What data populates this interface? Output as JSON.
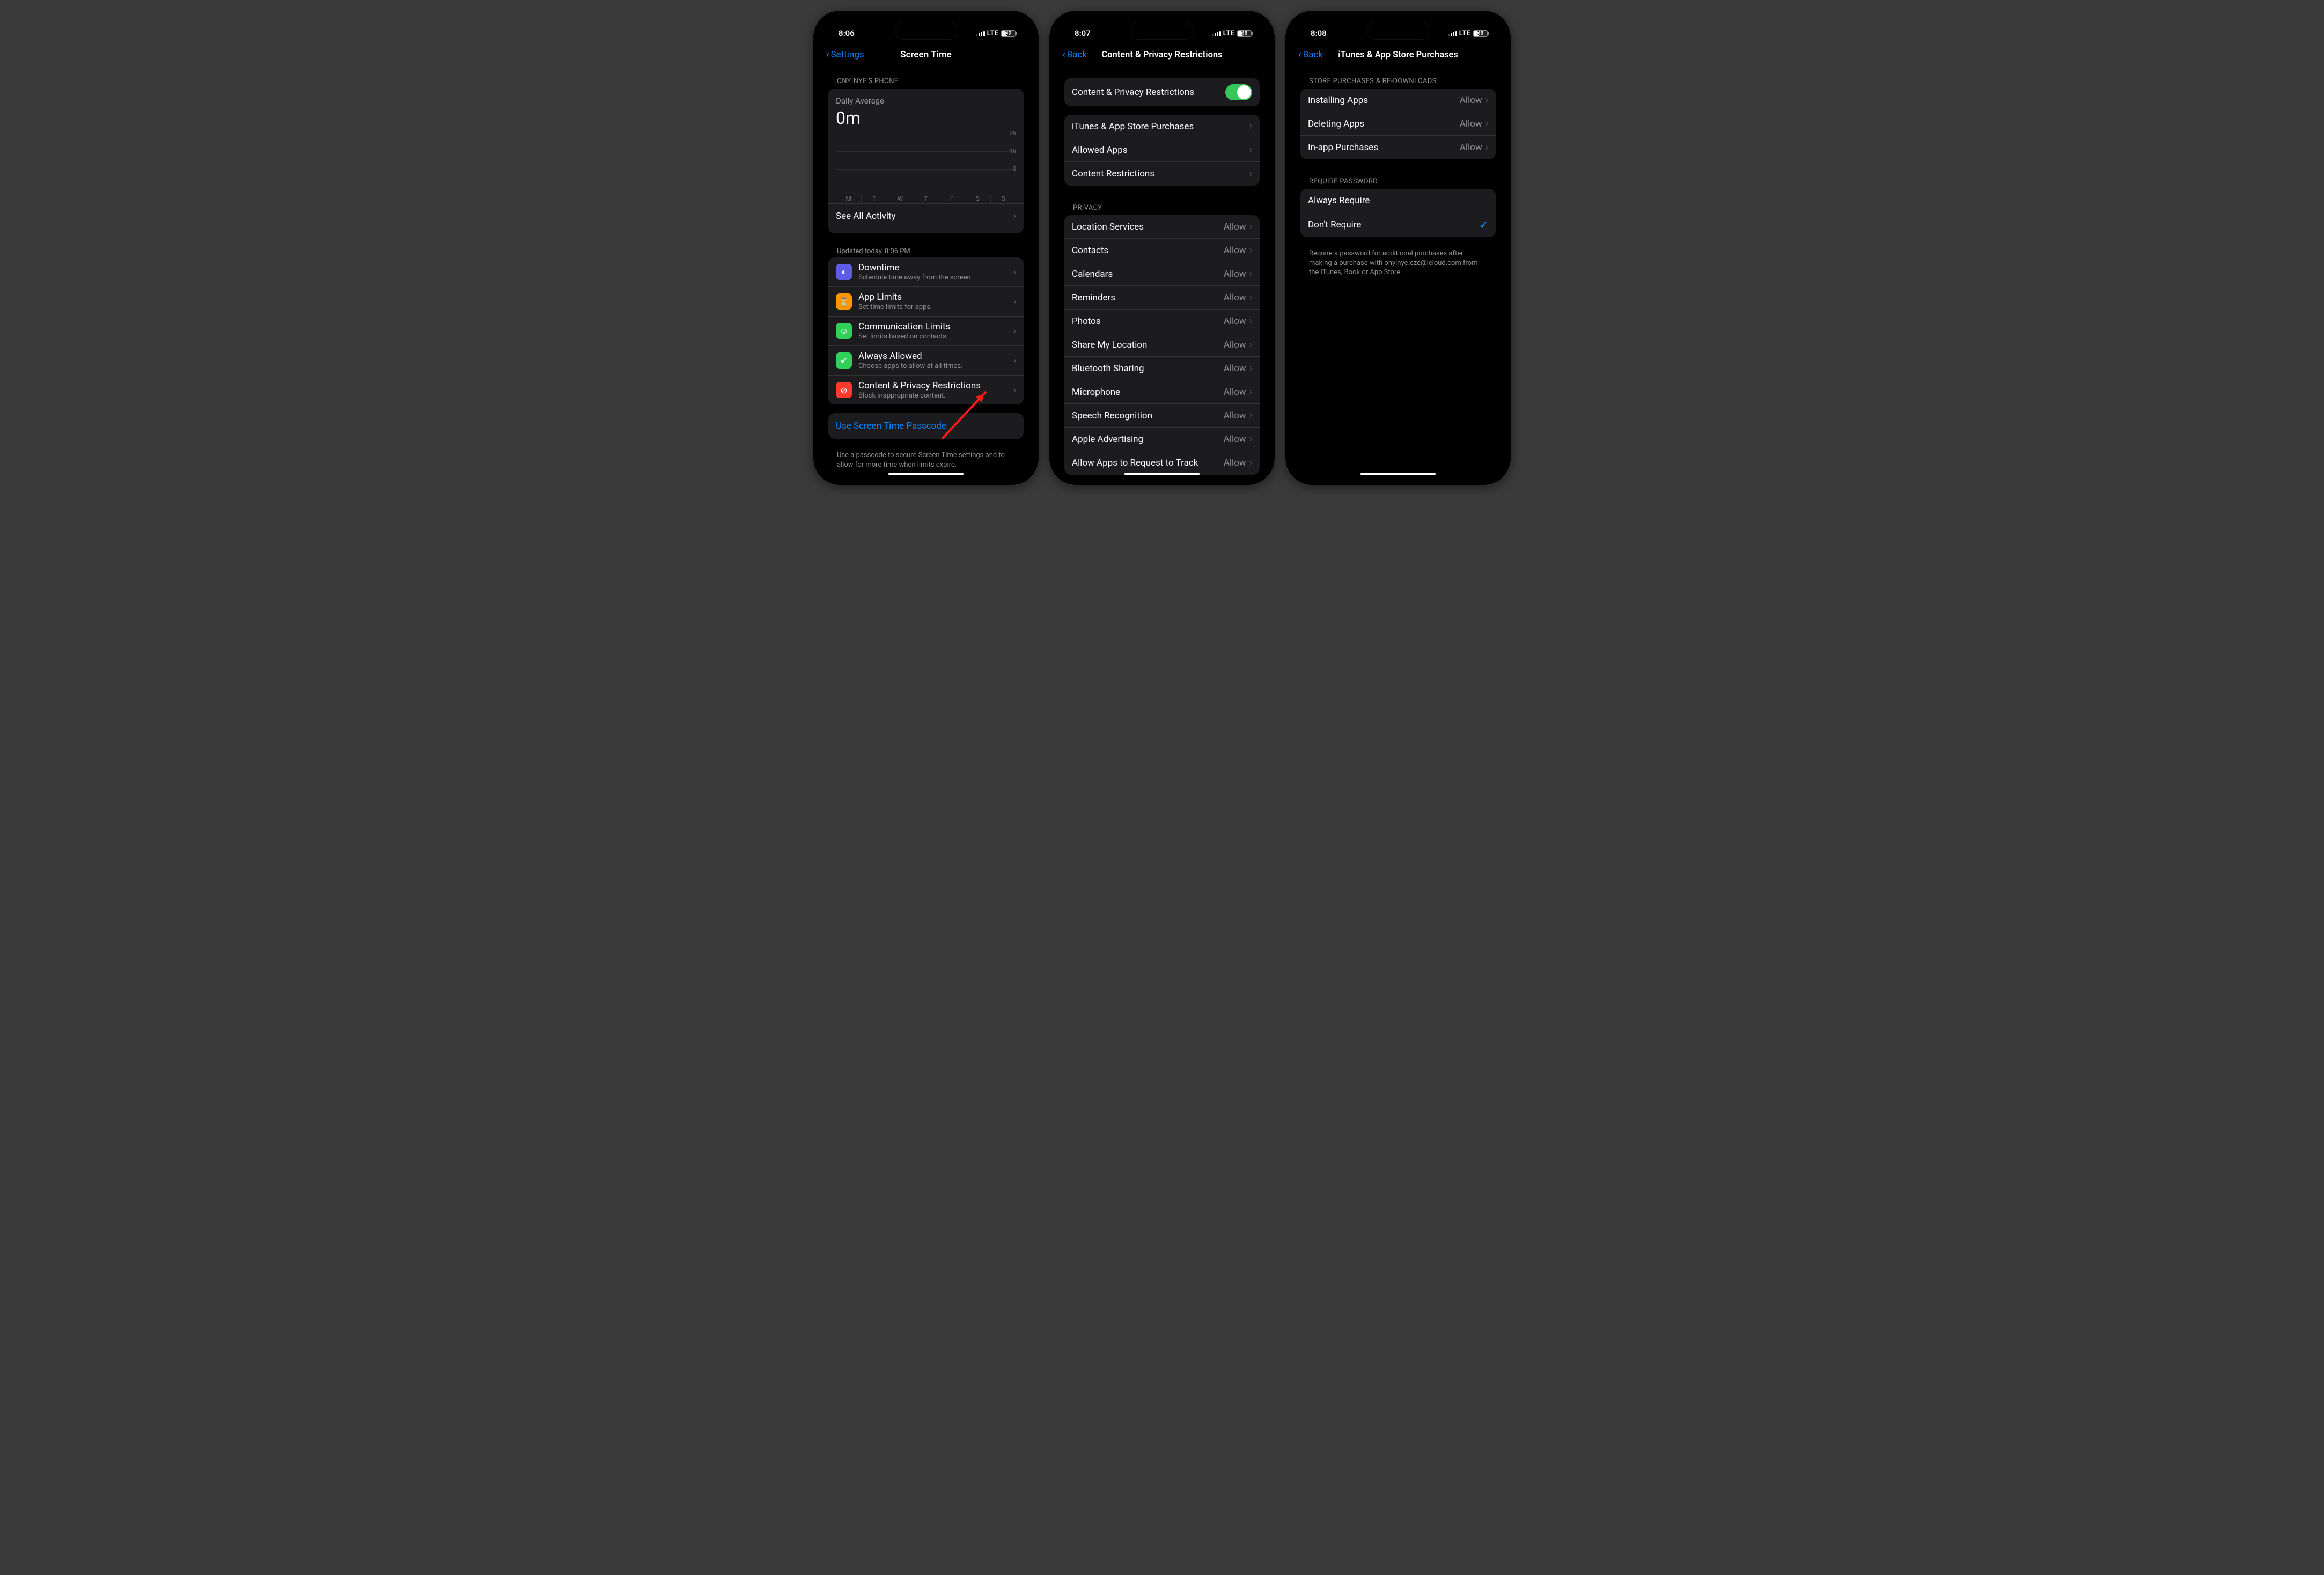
{
  "screens": [
    {
      "status": {
        "time": "8:06",
        "network": "LTE",
        "battery": "39"
      },
      "nav": {
        "back": "Settings",
        "title": "Screen Time"
      },
      "header": "ONYINYE'S PHONE",
      "daily": {
        "label": "Daily Average",
        "value": "0m",
        "ticks": [
          "2h",
          "1h",
          "0"
        ],
        "days": [
          "M",
          "T",
          "W",
          "T",
          "F",
          "S",
          "S"
        ]
      },
      "activity": "See All Activity",
      "updated": "Updated today, 8:06 PM",
      "options": [
        {
          "title": "Downtime",
          "sub": "Schedule time away from the screen."
        },
        {
          "title": "App Limits",
          "sub": "Set time limits for apps."
        },
        {
          "title": "Communication Limits",
          "sub": "Set limits based on contacts."
        },
        {
          "title": "Always Allowed",
          "sub": "Choose apps to allow at all times."
        },
        {
          "title": "Content & Privacy Restrictions",
          "sub": "Block inappropriate content."
        }
      ],
      "passcode": "Use Screen Time Passcode",
      "passcode_footer": "Use a passcode to secure Screen Time settings and to allow for more time when limits expire."
    },
    {
      "status": {
        "time": "8:07",
        "network": "LTE",
        "battery": "38"
      },
      "nav": {
        "back": "Back",
        "title": "Content & Privacy Restrictions"
      },
      "toggle_label": "Content & Privacy Restrictions",
      "main": [
        "iTunes & App Store Purchases",
        "Allowed Apps",
        "Content Restrictions"
      ],
      "privacy_header": "PRIVACY",
      "privacy": [
        {
          "label": "Location Services",
          "value": "Allow"
        },
        {
          "label": "Contacts",
          "value": "Allow"
        },
        {
          "label": "Calendars",
          "value": "Allow"
        },
        {
          "label": "Reminders",
          "value": "Allow"
        },
        {
          "label": "Photos",
          "value": "Allow"
        },
        {
          "label": "Share My Location",
          "value": "Allow"
        },
        {
          "label": "Bluetooth Sharing",
          "value": "Allow"
        },
        {
          "label": "Microphone",
          "value": "Allow"
        },
        {
          "label": "Speech Recognition",
          "value": "Allow"
        },
        {
          "label": "Apple Advertising",
          "value": "Allow"
        },
        {
          "label": "Allow Apps to Request to Track",
          "value": "Allow"
        }
      ]
    },
    {
      "status": {
        "time": "8:08",
        "network": "LTE",
        "battery": "38"
      },
      "nav": {
        "back": "Back",
        "title": "iTunes & App Store Purchases"
      },
      "header1": "STORE PURCHASES & RE-DOWNLOADS",
      "store": [
        {
          "label": "Installing Apps",
          "value": "Allow"
        },
        {
          "label": "Deleting Apps",
          "value": "Allow"
        },
        {
          "label": "In-app Purchases",
          "value": "Allow"
        }
      ],
      "header2": "REQUIRE PASSWORD",
      "require": [
        {
          "label": "Always Require",
          "selected": false
        },
        {
          "label": "Don't Require",
          "selected": true
        }
      ],
      "footer": "Require a password for additional purchases after making a purchase with onyinye.eze@icloud.com from the iTunes, Book or App Store."
    }
  ]
}
